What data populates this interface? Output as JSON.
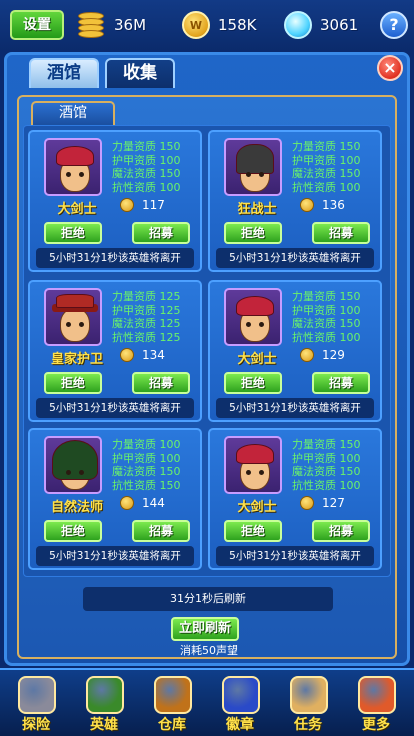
{
  "topbar": {
    "settings_label": "设置",
    "gold": "36M",
    "coins": "158K",
    "gems": "3061",
    "coin_symbol": "W",
    "help_label": "?"
  },
  "tabs": [
    {
      "label": "酒馆",
      "active": true
    },
    {
      "label": "收集",
      "active": false
    }
  ],
  "close_label": "×",
  "subtab_label": "酒馆",
  "heroes": [
    {
      "name": "大剑士",
      "price": "117",
      "portrait": "swordsman",
      "stats": [
        "力量资质 150",
        "护甲资质 100",
        "魔法资质 150",
        "抗性资质 100"
      ],
      "reject": "拒绝",
      "recruit": "招募",
      "timer": "5小时31分1秒该英雄将离开"
    },
    {
      "name": "狂战士",
      "price": "136",
      "portrait": "berserker",
      "stats": [
        "力量资质 150",
        "护甲资质 100",
        "魔法资质 150",
        "抗性资质 100"
      ],
      "reject": "拒绝",
      "recruit": "招募",
      "timer": "5小时31分1秒该英雄将离开"
    },
    {
      "name": "皇家护卫",
      "price": "134",
      "portrait": "guard",
      "stats": [
        "力量资质 125",
        "护甲资质 125",
        "魔法资质 125",
        "抗性资质 125"
      ],
      "reject": "拒绝",
      "recruit": "招募",
      "timer": "5小时31分1秒该英雄将离开"
    },
    {
      "name": "大剑士",
      "price": "129",
      "portrait": "swordsman",
      "stats": [
        "力量资质 150",
        "护甲资质 100",
        "魔法资质 150",
        "抗性资质 100"
      ],
      "reject": "拒绝",
      "recruit": "招募",
      "timer": "5小时31分1秒该英雄将离开"
    },
    {
      "name": "自然法师",
      "price": "144",
      "portrait": "mage",
      "stats": [
        "力量资质 100",
        "护甲资质 100",
        "魔法资质 150",
        "抗性资质 150"
      ],
      "reject": "拒绝",
      "recruit": "招募",
      "timer": "5小时31分1秒该英雄将离开"
    },
    {
      "name": "大剑士",
      "price": "127",
      "portrait": "swordsman",
      "stats": [
        "力量资质 150",
        "护甲资质 100",
        "魔法资质 150",
        "抗性资质 100"
      ],
      "reject": "拒绝",
      "recruit": "招募",
      "timer": "5小时31分1秒该英雄将离开"
    }
  ],
  "refresh": {
    "info": "31分1秒后刷新",
    "button": "立即刷新",
    "cost": "消耗50声望"
  },
  "nav": [
    {
      "label": "探险",
      "icon": "helmet-icon",
      "color": "#8a8a9a"
    },
    {
      "label": "英雄",
      "icon": "hero-icon",
      "color": "#3a8a2a"
    },
    {
      "label": "仓库",
      "icon": "chest-icon",
      "color": "#c0721a"
    },
    {
      "label": "徽章",
      "icon": "emblem-icon",
      "color": "#2a4ac8"
    },
    {
      "label": "任务",
      "icon": "scroll-icon",
      "color": "#e0b060"
    },
    {
      "label": "更多",
      "icon": "more-icon",
      "color": "#e05a2a"
    }
  ]
}
